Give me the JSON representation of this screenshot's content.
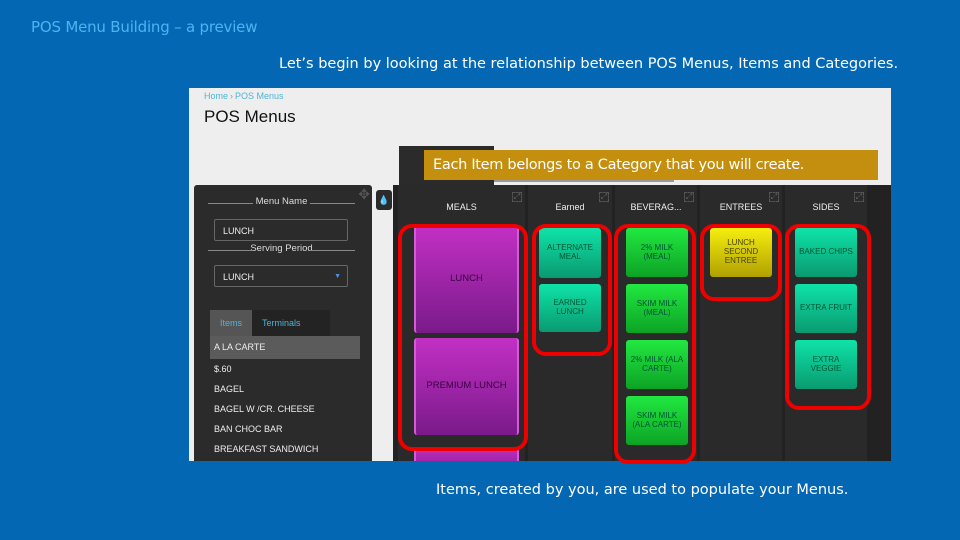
{
  "slide": {
    "title": "POS Menu Building – a preview",
    "caption_top": "Let’s begin by looking at the relationship between POS Menus, Items and Categories.",
    "callout": "Each Item belongs to a Category that you will create.",
    "caption_bottom": "Items, created by you, are used to populate your Menus."
  },
  "app": {
    "breadcrumb": [
      "Home",
      "POS Menus"
    ],
    "breadcrumb_sep": "›",
    "page_title": "POS Menus",
    "left_panel": {
      "menu_name_label": "Menu Name",
      "menu_name_value": "LUNCH",
      "serving_period_label": "Serving Period",
      "serving_period_value": "LUNCH",
      "tabs": [
        {
          "label": "Items",
          "active": true
        },
        {
          "label": "Terminals",
          "active": false
        }
      ],
      "items": [
        "A LA CARTE",
        "$.60",
        "BAGEL",
        "BAGEL W /CR. CHEESE",
        "BAN CHOC BAR",
        "BREAKFAST SANDWICH"
      ]
    },
    "categories": [
      {
        "name": "MEALS",
        "color": "purple",
        "items": [
          "LUNCH",
          "PREMIUM LUNCH"
        ]
      },
      {
        "name": "Earned",
        "color": "teal",
        "items": [
          "ALTERNATE MEAL",
          "EARNED LUNCH"
        ]
      },
      {
        "name": "BEVERAG...",
        "color": "green",
        "items": [
          "2% MILK (MEAL)",
          "SKIM MILK (MEAL)",
          "2% MILK (ALA CARTE)",
          "SKIM MILK (ALA CARTE)"
        ]
      },
      {
        "name": "ENTREES",
        "color": "yellow",
        "items": [
          "LUNCH SECOND ENTREE"
        ]
      },
      {
        "name": "SIDES",
        "color": "teal",
        "items": [
          "BAKED CHIPS",
          "EXTRA FRUIT",
          "EXTRA VEGGIE"
        ]
      }
    ],
    "colors": {
      "highlight": "#ee0000",
      "callout_bg": "#c48f0f",
      "slide_bg": "#0467b3",
      "link": "#4fb4d8"
    }
  }
}
